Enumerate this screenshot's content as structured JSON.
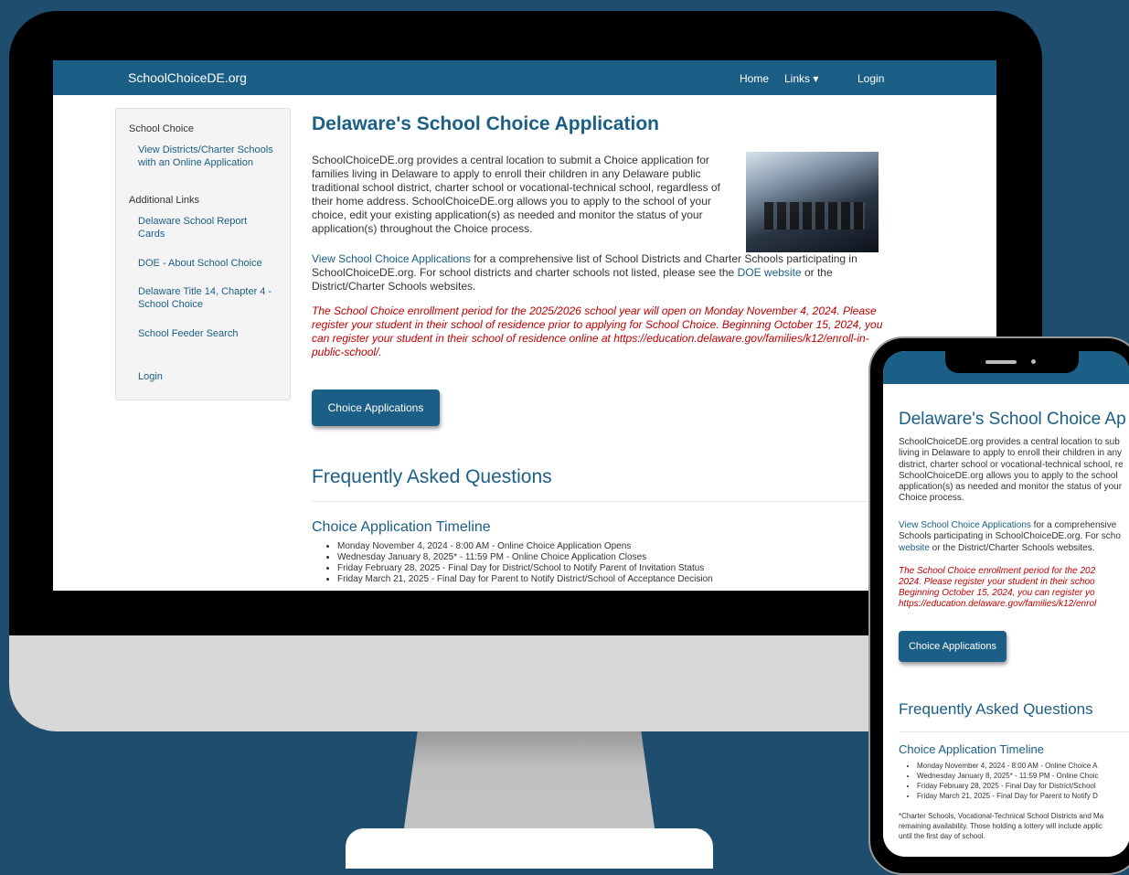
{
  "site": {
    "brand": "SchoolChoiceDE.org",
    "nav": {
      "home": "Home",
      "links": "Links ▾",
      "login": "Login"
    }
  },
  "sidebar": {
    "heading1": "School Choice",
    "link1": "View Districts/Charter Schools with an Online Application",
    "heading2": "Additional Links",
    "link2": "Delaware School Report Cards",
    "link3": "DOE - About School Choice",
    "link4": "Delaware Title 14, Chapter 4 - School Choice",
    "link5": "School Feeder Search",
    "link6": "Login"
  },
  "main": {
    "title": "Delaware's School Choice Application",
    "intro": "SchoolChoiceDE.org provides a central location to submit a Choice application for families living in Delaware to apply to enroll their children in any Delaware public traditional school district, charter school or vocational-technical school, regardless of their home address. SchoolChoiceDE.org allows you to apply to the school of your choice, edit your existing application(s) as needed and monitor the status of your application(s) throughout the Choice process.",
    "p2_link": "View School Choice Applications",
    "p2_text": " for a comprehensive list of School Districts and Charter Schools participating in SchoolChoiceDE.org. For school districts and charter schools not listed, please see the ",
    "p2_link2": "DOE website",
    "p2_end": " or the District/Charter Schools websites.",
    "notice": "The School Choice enrollment period for the 2025/2026 school year will open on Monday November 4, 2024. Please register your student in their school of residence prior to applying for School Choice. Beginning October 15, 2024, you can register your student in their school of residence online at https://education.delaware.gov/families/k12/enroll-in-public-school/.",
    "button": "Choice Applications",
    "faq_title": "Frequently Asked Questions",
    "timeline_title": "Choice Application Timeline",
    "timeline": [
      "Monday November 4, 2024 - 8:00 AM - Online Choice Application Opens",
      "Wednesday January 8, 2025* - 11:59 PM - Online Choice Application Closes",
      "Friday February 28, 2025 - Final Day for District/School to Notify Parent of Invitation Status",
      "Friday March 21, 2025 - Final Day for Parent to Notify District/School of Acceptance Decision"
    ]
  },
  "phone": {
    "title": "Delaware's School Choice Ap",
    "intro": "SchoolChoiceDE.org provides a central location to sub\nliving in Delaware to apply to enroll their children in any\ndistrict, charter school or vocational-technical school, re\nSchoolChoiceDE.org allows you to apply to the school\napplication(s) as needed and monitor the status of your\nChoice process.",
    "p2_link": "View School Choice Applications",
    "p2_text": " for a comprehensive\nSchools participating in SchoolChoiceDE.org. For scho\n",
    "p2_link2": "website",
    "p2_end": " or the District/Charter Schools websites.",
    "notice": "The School Choice enrollment period for the 202\n2024. Please register your student in their schoo\nBeginning October 15, 2024, you can register yo\nhttps://education.delaware.gov/families/k12/enrol",
    "button": "Choice Applications",
    "faq_title": "Frequently Asked Questions",
    "timeline_title": "Choice Application Timeline",
    "timeline": [
      "Monday November 4, 2024 - 8:00 AM - Online Choice A",
      "Wednesday January 8, 2025* - 11:59 PM - Online Choic",
      "Friday February 28, 2025 - Final Day for District/School",
      "Friday March 21, 2025 - Final Day for Parent to Notify D"
    ],
    "footnote": "*Charter Schools, Vocational-Technical School Districts and Ma\nremaining availability. Those holding a lottery will include applic\nuntil the first day of school."
  },
  "colors": {
    "accent": "#1b5e86",
    "notice": "#c00000",
    "background": "#1e4d6e"
  }
}
